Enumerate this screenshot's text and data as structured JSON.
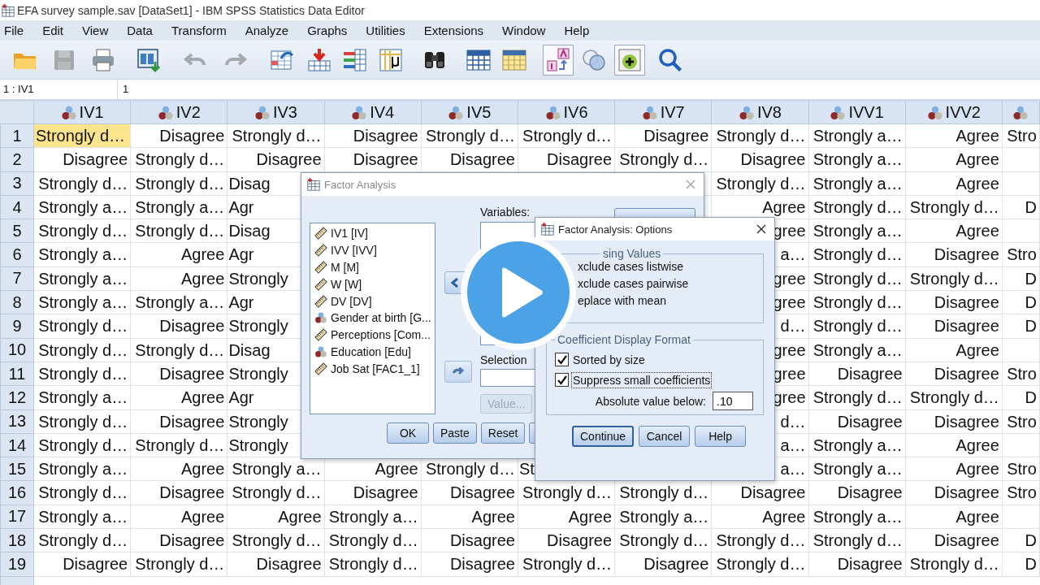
{
  "window": {
    "title": "EFA survey sample.sav [DataSet1] - IBM SPSS Statistics Data Editor"
  },
  "menu": [
    "File",
    "Edit",
    "View",
    "Data",
    "Transform",
    "Analyze",
    "Graphs",
    "Utilities",
    "Extensions",
    "Window",
    "Help"
  ],
  "toolbar": [
    {
      "kind": "open",
      "disabled": false,
      "on": false
    },
    {
      "kind": "save",
      "disabled": true,
      "on": false
    },
    {
      "kind": "print",
      "disabled": false,
      "on": false
    },
    {
      "kind": "recall",
      "disabled": false,
      "on": false
    },
    {
      "kind": "undo",
      "disabled": true,
      "on": false
    },
    {
      "kind": "redo",
      "disabled": true,
      "on": false
    },
    {
      "kind": "goto-case",
      "disabled": false,
      "on": false
    },
    {
      "kind": "goto-variable",
      "disabled": false,
      "on": false
    },
    {
      "kind": "variables",
      "disabled": false,
      "on": false
    },
    {
      "kind": "statistics",
      "disabled": false,
      "on": false
    },
    {
      "kind": "find",
      "disabled": false,
      "on": false
    },
    {
      "kind": "split",
      "disabled": false,
      "on": false
    },
    {
      "kind": "select",
      "disabled": false,
      "on": false
    },
    {
      "kind": "value-labels",
      "disabled": false,
      "on": true
    },
    {
      "kind": "variable-sets",
      "disabled": false,
      "on": false
    },
    {
      "kind": "show-all",
      "disabled": false,
      "on": true
    },
    {
      "kind": "search",
      "disabled": false,
      "on": false
    }
  ],
  "cell_editor": {
    "cell": "1 : IV1",
    "value": "1"
  },
  "grid": {
    "columns": [
      {
        "name": "IV1"
      },
      {
        "name": "IV2"
      },
      {
        "name": "IV3"
      },
      {
        "name": "IV4"
      },
      {
        "name": "IV5"
      },
      {
        "name": "IV6"
      },
      {
        "name": "IV7"
      },
      {
        "name": "IV8"
      },
      {
        "name": "IVV1"
      },
      {
        "name": "IVV2"
      }
    ],
    "rows": [
      {
        "number": "1",
        "cells": [
          {
            "text": "Strongly d…",
            "selected": true
          },
          {
            "text": "Disagree",
            "selected": false
          },
          {
            "text": "Strongly d…",
            "selected": false
          },
          {
            "text": "Disagree",
            "selected": false
          },
          {
            "text": "Strongly d…",
            "selected": false
          },
          {
            "text": "Strongly d…",
            "selected": false
          },
          {
            "text": "Disagree",
            "selected": false
          },
          {
            "text": "Strongly d…",
            "selected": false
          },
          {
            "text": "Strongly a…",
            "selected": false
          },
          {
            "text": "Agree",
            "selected": false
          },
          {
            "text": "Stro",
            "selected": false
          }
        ]
      },
      {
        "number": "2",
        "cells": [
          {
            "text": "Disagree",
            "selected": false
          },
          {
            "text": "Strongly d…",
            "selected": false
          },
          {
            "text": "Disagree",
            "selected": false
          },
          {
            "text": "Disagree",
            "selected": false
          },
          {
            "text": "Disagree",
            "selected": false
          },
          {
            "text": "Disagree",
            "selected": false
          },
          {
            "text": "Strongly d…",
            "selected": false
          },
          {
            "text": "Disagree",
            "selected": false
          },
          {
            "text": "Strongly a…",
            "selected": false
          },
          {
            "text": "Agree",
            "selected": false
          },
          null
        ]
      },
      {
        "number": "3",
        "cells": [
          {
            "text": "Strongly d…",
            "selected": false
          },
          {
            "text": "Strongly d…",
            "selected": false
          },
          {
            "text": "Disag",
            "selected": false
          },
          null,
          null,
          null,
          null,
          {
            "text": "Strongly d…",
            "selected": false
          },
          {
            "text": "Strongly a…",
            "selected": false
          },
          {
            "text": "Agree",
            "selected": false
          },
          null
        ]
      },
      {
        "number": "4",
        "cells": [
          {
            "text": "Strongly a…",
            "selected": false
          },
          {
            "text": "Strongly a…",
            "selected": false
          },
          {
            "text": "Agr",
            "selected": false
          },
          null,
          null,
          null,
          null,
          {
            "text": "Agree",
            "selected": false
          },
          {
            "text": "Strongly d…",
            "selected": false
          },
          {
            "text": "Strongly d…",
            "selected": false
          },
          {
            "text": "D",
            "selected": false
          }
        ]
      },
      {
        "number": "5",
        "cells": [
          {
            "text": "Strongly d…",
            "selected": false
          },
          {
            "text": "Strongly d…",
            "selected": false
          },
          {
            "text": "Disag",
            "selected": false
          },
          null,
          null,
          null,
          null,
          {
            "text": "gree",
            "selected": false
          },
          {
            "text": "Strongly a…",
            "selected": false
          },
          {
            "text": "Agree",
            "selected": false
          },
          null
        ]
      },
      {
        "number": "6",
        "cells": [
          {
            "text": "Strongly a…",
            "selected": false
          },
          {
            "text": "Agree",
            "selected": false
          },
          {
            "text": "Agr",
            "selected": false
          },
          null,
          null,
          null,
          null,
          {
            "text": "a…",
            "selected": false
          },
          {
            "text": "Strongly d…",
            "selected": false
          },
          {
            "text": "Disagree",
            "selected": false
          },
          {
            "text": "Stro",
            "selected": false
          }
        ]
      },
      {
        "number": "7",
        "cells": [
          {
            "text": "Strongly a…",
            "selected": false
          },
          {
            "text": "Agree",
            "selected": false
          },
          {
            "text": "Strongly",
            "selected": false
          },
          null,
          null,
          null,
          null,
          {
            "text": "gree",
            "selected": false
          },
          {
            "text": "Strongly d…",
            "selected": false
          },
          {
            "text": "Strongly d…",
            "selected": false
          },
          {
            "text": "D",
            "selected": false
          }
        ]
      },
      {
        "number": "8",
        "cells": [
          {
            "text": "Strongly a…",
            "selected": false
          },
          {
            "text": "Strongly a…",
            "selected": false
          },
          {
            "text": "Agr",
            "selected": false
          },
          null,
          null,
          null,
          null,
          {
            "text": "gree",
            "selected": false
          },
          {
            "text": "Strongly d…",
            "selected": false
          },
          {
            "text": "Disagree",
            "selected": false
          },
          {
            "text": "D",
            "selected": false
          }
        ]
      },
      {
        "number": "9",
        "cells": [
          {
            "text": "Strongly d…",
            "selected": false
          },
          {
            "text": "Disagree",
            "selected": false
          },
          {
            "text": "Strongly",
            "selected": false
          },
          null,
          null,
          null,
          null,
          {
            "text": "d…",
            "selected": false
          },
          {
            "text": "Strongly d…",
            "selected": false
          },
          {
            "text": "Disagree",
            "selected": false
          },
          {
            "text": "D",
            "selected": false
          }
        ]
      },
      {
        "number": "10",
        "cells": [
          {
            "text": "Strongly d…",
            "selected": false
          },
          {
            "text": "Strongly d…",
            "selected": false
          },
          {
            "text": "Disag",
            "selected": false
          },
          null,
          null,
          null,
          null,
          {
            "text": "gree",
            "selected": false
          },
          {
            "text": "Strongly a…",
            "selected": false
          },
          {
            "text": "Agree",
            "selected": false
          },
          null
        ]
      },
      {
        "number": "11",
        "cells": [
          {
            "text": "Strongly d…",
            "selected": false
          },
          {
            "text": "Disagree",
            "selected": false
          },
          {
            "text": "Strongly",
            "selected": false
          },
          null,
          null,
          null,
          null,
          {
            "text": "gree",
            "selected": false
          },
          {
            "text": "Disagree",
            "selected": false
          },
          {
            "text": "Disagree",
            "selected": false
          },
          {
            "text": "Stro",
            "selected": false
          }
        ]
      },
      {
        "number": "12",
        "cells": [
          {
            "text": "Strongly a…",
            "selected": false
          },
          {
            "text": "Agree",
            "selected": false
          },
          {
            "text": "Agr",
            "selected": false
          },
          null,
          null,
          null,
          null,
          {
            "text": "gree",
            "selected": false
          },
          {
            "text": "Strongly d…",
            "selected": false
          },
          {
            "text": "Strongly d…",
            "selected": false
          },
          {
            "text": "D",
            "selected": false
          }
        ]
      },
      {
        "number": "13",
        "cells": [
          {
            "text": "Strongly d…",
            "selected": false
          },
          {
            "text": "Disagree",
            "selected": false
          },
          {
            "text": "Strongly",
            "selected": false
          },
          null,
          null,
          null,
          null,
          {
            "text": "d…",
            "selected": false
          },
          {
            "text": "Disagree",
            "selected": false
          },
          {
            "text": "Disagree",
            "selected": false
          },
          {
            "text": "Stro",
            "selected": false
          }
        ]
      },
      {
        "number": "14",
        "cells": [
          {
            "text": "Strongly d…",
            "selected": false
          },
          {
            "text": "Strongly d…",
            "selected": false
          },
          {
            "text": "Strongly",
            "selected": false
          },
          null,
          null,
          null,
          null,
          {
            "text": "a…",
            "selected": false
          },
          {
            "text": "Strongly a…",
            "selected": false
          },
          {
            "text": "Agree",
            "selected": false
          },
          null
        ]
      },
      {
        "number": "15",
        "cells": [
          {
            "text": "Strongly a…",
            "selected": false
          },
          {
            "text": "Agree",
            "selected": false
          },
          {
            "text": "Strongly a…",
            "selected": false
          },
          {
            "text": "Agree",
            "selected": false
          },
          {
            "text": "Strongly d…",
            "selected": false
          },
          {
            "text": "St",
            "selected": false
          },
          null,
          {
            "text": "a…",
            "selected": false
          },
          {
            "text": "Strongly a…",
            "selected": false
          },
          {
            "text": "Agree",
            "selected": false
          },
          {
            "text": "Stro",
            "selected": false
          }
        ]
      },
      {
        "number": "16",
        "cells": [
          {
            "text": "Strongly d…",
            "selected": false
          },
          {
            "text": "Disagree",
            "selected": false
          },
          {
            "text": "Strongly d…",
            "selected": false
          },
          {
            "text": "Disagree",
            "selected": false
          },
          {
            "text": "Disagree",
            "selected": false
          },
          {
            "text": "Strongly d…",
            "selected": false
          },
          {
            "text": "Strongly d…",
            "selected": false
          },
          {
            "text": "Disagree",
            "selected": false
          },
          {
            "text": "Disagree",
            "selected": false
          },
          {
            "text": "Disagree",
            "selected": false
          },
          {
            "text": "Stro",
            "selected": false
          }
        ]
      },
      {
        "number": "17",
        "cells": [
          {
            "text": "Strongly a…",
            "selected": false
          },
          {
            "text": "Agree",
            "selected": false
          },
          {
            "text": "Agree",
            "selected": false
          },
          {
            "text": "Strongly a…",
            "selected": false
          },
          {
            "text": "Agree",
            "selected": false
          },
          {
            "text": "Agree",
            "selected": false
          },
          {
            "text": "Strongly a…",
            "selected": false
          },
          {
            "text": "Agree",
            "selected": false
          },
          {
            "text": "Strongly a…",
            "selected": false
          },
          {
            "text": "Agree",
            "selected": false
          },
          null
        ]
      },
      {
        "number": "18",
        "cells": [
          {
            "text": "Strongly d…",
            "selected": false
          },
          {
            "text": "Disagree",
            "selected": false
          },
          {
            "text": "Strongly d…",
            "selected": false
          },
          {
            "text": "Strongly d…",
            "selected": false
          },
          {
            "text": "Disagree",
            "selected": false
          },
          {
            "text": "Disagree",
            "selected": false
          },
          {
            "text": "Strongly d…",
            "selected": false
          },
          {
            "text": "Strongly d…",
            "selected": false
          },
          {
            "text": "Strongly d…",
            "selected": false
          },
          {
            "text": "Disagree",
            "selected": false
          },
          {
            "text": "D",
            "selected": false
          }
        ]
      },
      {
        "number": "19",
        "cells": [
          {
            "text": "Disagree",
            "selected": false
          },
          {
            "text": "Strongly d…",
            "selected": false
          },
          {
            "text": "Disagree",
            "selected": false
          },
          {
            "text": "Strongly d…",
            "selected": false
          },
          {
            "text": "Disagree",
            "selected": false
          },
          {
            "text": "Strongly d…",
            "selected": false
          },
          {
            "text": "Disagree",
            "selected": false
          },
          {
            "text": "Strongly d…",
            "selected": false
          },
          {
            "text": "Disagree",
            "selected": false
          },
          {
            "text": "Strongly d…",
            "selected": false
          },
          {
            "text": "D",
            "selected": false
          }
        ]
      }
    ]
  },
  "factor_dialog": {
    "title": "Factor Analysis",
    "active": false,
    "source_variables": [
      {
        "label": "IV1 [IV]",
        "kind": "scale"
      },
      {
        "label": "IVV [IVV]",
        "kind": "scale"
      },
      {
        "label": "M [M]",
        "kind": "scale"
      },
      {
        "label": "W [W]",
        "kind": "scale"
      },
      {
        "label": "DV [DV]",
        "kind": "scale"
      },
      {
        "label": "Gender at birth [G...",
        "kind": "nominal"
      },
      {
        "label": "Perceptions [Com...",
        "kind": "scale"
      },
      {
        "label": "Education [Edu]",
        "kind": "nominal"
      },
      {
        "label": "Job Sat [FAC1_1]",
        "kind": "scale"
      }
    ],
    "variables_label": "Variables:",
    "selection_label": "Selection",
    "value_button": {
      "label": "Value...",
      "disabled": true
    },
    "buttons": [
      "OK",
      "Paste",
      "Reset"
    ]
  },
  "options_dialog": {
    "title": "Factor Analysis: Options",
    "active": true,
    "missing_values": {
      "legend": "sing Values",
      "options": [
        "xclude cases listwise",
        "xclude cases pairwise",
        "eplace with mean"
      ]
    },
    "coefficient_format": {
      "legend": "Coefficient Display Format",
      "checkboxes": [
        {
          "label": "Sorted by size",
          "checked": true,
          "focused": false
        },
        {
          "label": "Suppress small coefficients",
          "checked": true,
          "focused": true
        }
      ],
      "threshold_label": "Absolute value below:",
      "threshold_value": ".10"
    },
    "buttons": [
      {
        "label": "Continue",
        "default": true
      },
      {
        "label": "Cancel",
        "default": false
      },
      {
        "label": "Help",
        "default": false
      }
    ]
  }
}
